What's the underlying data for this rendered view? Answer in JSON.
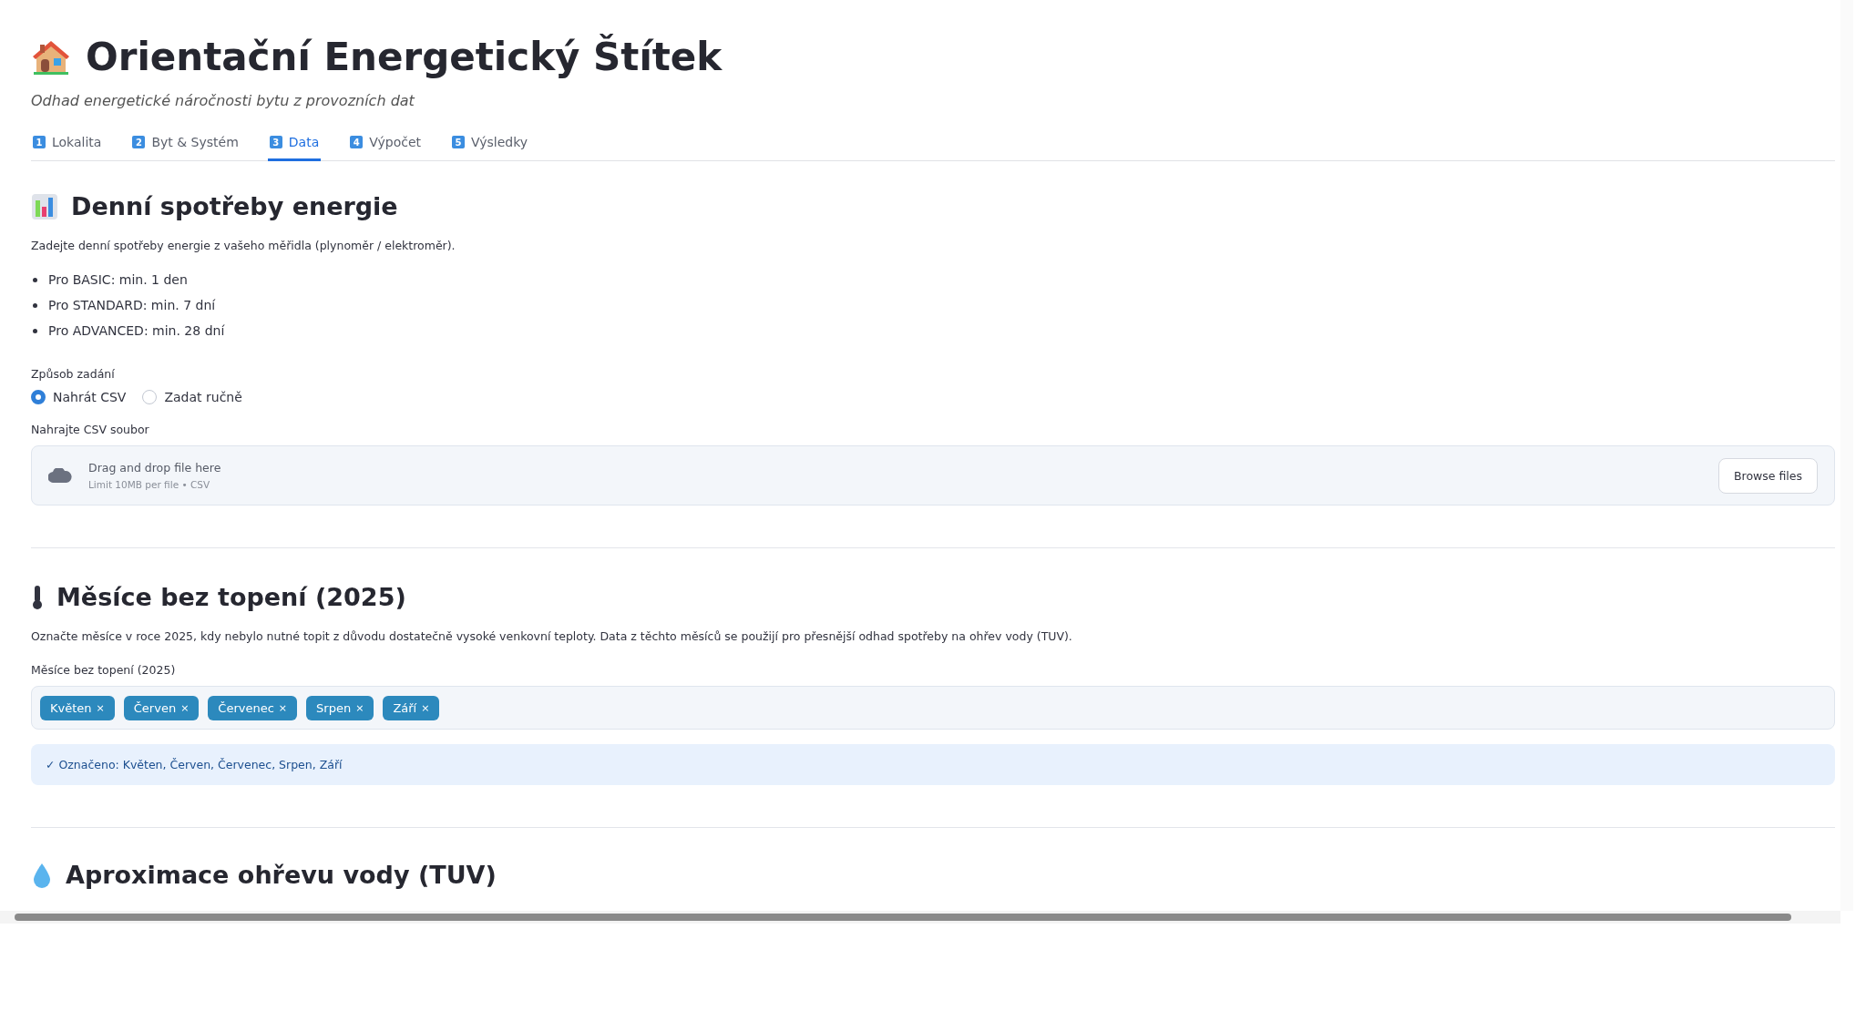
{
  "header": {
    "title": "Orientační Energetický Štítek",
    "subtitle": "Odhad energetické náročnosti bytu z provozních dat"
  },
  "tabs": [
    {
      "number": "1",
      "label": "Lokalita",
      "selected": false
    },
    {
      "number": "2",
      "label": "Byt & Systém",
      "selected": false
    },
    {
      "number": "3",
      "label": "Data",
      "selected": true
    },
    {
      "number": "4",
      "label": "Výpočet",
      "selected": false
    },
    {
      "number": "5",
      "label": "Výsledky",
      "selected": false
    }
  ],
  "daily": {
    "heading": "Denní spotřeby energie",
    "intro": "Zadejte denní spotřeby energie z vašeho měřidla (plynoměr / elektroměr).",
    "bullets": [
      "Pro BASIC: min. 1 den",
      "Pro STANDARD: min. 7 dní",
      "Pro ADVANCED: min. 28 dní"
    ],
    "method_label": "Způsob zadání",
    "methods": [
      {
        "label": "Nahrát CSV",
        "selected": true
      },
      {
        "label": "Zadat ručně",
        "selected": false
      }
    ],
    "upload_label": "Nahrajte CSV soubor",
    "uploader": {
      "title": "Drag and drop file here",
      "hint": "Limit 10MB per file • CSV",
      "button": "Browse files"
    }
  },
  "months": {
    "heading": "Měsíce bez topení (2025)",
    "intro": "Označte měsíce v roce 2025, kdy nebylo nutné topit z důvodu dostatečně vysoké venkovní teploty. Data z těchto měsíců se použijí pro přesnější odhad spotřeby na ohřev vody (TUV).",
    "field_label": "Měsíce bez topení (2025)",
    "chips": [
      {
        "label": "Květen",
        "remove": "×"
      },
      {
        "label": "Červen",
        "remove": "×"
      },
      {
        "label": "Červenec",
        "remove": "×"
      },
      {
        "label": "Srpen",
        "remove": "×"
      },
      {
        "label": "Září",
        "remove": "×"
      }
    ],
    "info": "✓ Označeno: Květen, Červen, Červenec, Srpen, Září"
  },
  "next_section": {
    "heading": "Aproximace ohřevu vody (TUV)"
  }
}
